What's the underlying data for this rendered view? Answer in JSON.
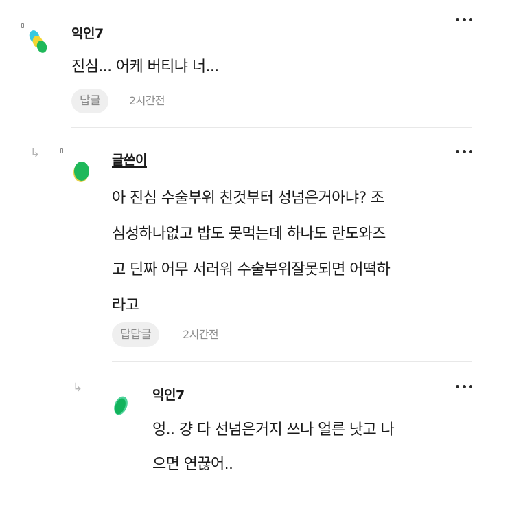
{
  "comments": [
    {
      "nickname": "익인7",
      "text": "진심... 어케 버티냐 너...",
      "reply_label": "답글",
      "time": "2시간전",
      "avatar_icon": "tricolor-blob-avatar-icon",
      "avatar_colors": [
        "#37c9e0",
        "#f2d633",
        "#1fb85a"
      ]
    },
    {
      "nickname": "글쓴이",
      "text": "아 진심 수술부위 친것부터 성넘은거아냐? 조\n심성하나없고 밥도 못먹는데 하나도 란도와즈\n고 딘짜 어무 서러워 수술부위잘못되면 어떡하\n라고",
      "reply_label": "답답글",
      "time": "2시간전",
      "avatar_icon": "green-blob-avatar-icon",
      "avatar_colors": [
        "#e7d24a",
        "#1fb85a"
      ]
    },
    {
      "nickname": "익인7",
      "text": "엉.. 걍 다 선넘은거지 쓰나 얼른 낫고 나\n으면 연끊어..",
      "avatar_icon": "green-blob-avatar-icon",
      "avatar_colors": [
        "#4fd39a",
        "#12b35c"
      ]
    }
  ],
  "icons": {
    "more": "more-options-icon",
    "reply_arrow": "reply-arrow-icon"
  },
  "glyphs": {
    "reply_arrow": "↳"
  }
}
